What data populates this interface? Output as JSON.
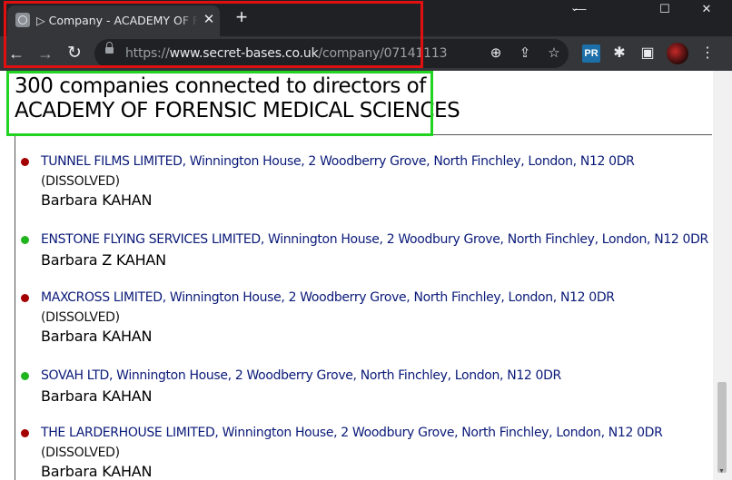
{
  "browser": {
    "tab_title": "▷ Company - ACADEMY OF FORENSIC MEDICAL SCIENCES",
    "tab_close": "✕",
    "new_tab": "+",
    "window_minimize": "—",
    "window_maximize": "☐",
    "window_close": "✕",
    "tab_search": "⌄",
    "url_scheme": "https://",
    "url_host": "www.secret-bases.co.uk",
    "url_path": "/company/07141113",
    "extension_badge": "PR",
    "icons": {
      "back": "arrow-left-icon",
      "forward": "arrow-right-icon",
      "reload": "reload-icon",
      "lock": "lock-icon",
      "zoom": "zoom-icon",
      "share": "share-icon",
      "bookmark": "star-icon",
      "extensions": "puzzle-icon",
      "side_panel": "side-panel-icon",
      "menu": "kebab-menu-icon"
    }
  },
  "page": {
    "heading_line1": "300 companies connected to directors of",
    "heading_line2": "ACADEMY OF FORENSIC MEDICAL SCIENCES",
    "entries": [
      {
        "company": "TUNNEL FILMS LIMITED",
        "address": ", Winnington House, 2 Woodberry Grove, North Finchley, London, N12 0DR",
        "status": "(DISSOLVED)",
        "person": "Barbara KAHAN",
        "indicator_color": "#a40000"
      },
      {
        "company": "ENSTONE FLYING SERVICES LIMITED",
        "address": ", Winnington House, 2 Woodbury Grove, North Finchley, London, N12 0DR",
        "status": "",
        "person": "Barbara Z KAHAN",
        "indicator_color": "#1fb51f"
      },
      {
        "company": "MAXCROSS LIMITED",
        "address": ", Winnington House, 2 Woodberry Grove, North Finchley, London, N12 0DR",
        "status": "(DISSOLVED)",
        "person": "Barbara KAHAN",
        "indicator_color": "#a40000"
      },
      {
        "company": "SOVAH LTD",
        "address": ", Winnington House, 2 Woodberry Grove, North Finchley, London, N12 0DR",
        "status": "",
        "person": "Barbara KAHAN",
        "indicator_color": "#1fb51f"
      },
      {
        "company": "THE LARDERHOUSE LIMITED",
        "address": ", Winnington House, 2 Woodbury Grove, North Finchley, London, N12 0DR",
        "status": "(DISSOLVED)",
        "person": "Barbara KAHAN",
        "indicator_color": "#a40000"
      }
    ]
  },
  "annotation_colors": {
    "red_box": "#e01010",
    "green_box": "#22d322"
  }
}
